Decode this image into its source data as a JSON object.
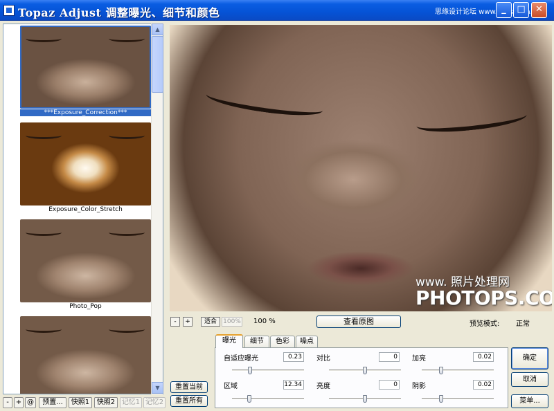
{
  "window": {
    "title": "Topaz Adjust 调整曝光、细节和颜色",
    "watermark": "思缘设计论坛 www.missyuan.com",
    "controls": {
      "minimize": "_",
      "maximize": "□",
      "close": "✕"
    }
  },
  "presets": {
    "items": [
      {
        "label": "***Exposure_Correction***",
        "selected": true
      },
      {
        "label": "Exposure_Color_Stretch",
        "selected": false
      },
      {
        "label": "Photo_Pop",
        "selected": false
      },
      {
        "label": "",
        "selected": false
      }
    ],
    "scroll_up": "▲",
    "scroll_down": "▼"
  },
  "left_toolbar": {
    "minus": "-",
    "plus": "+",
    "at": "@",
    "preset": "预置...",
    "snapshot1": "快照1",
    "snapshot2": "快照2",
    "memory1": "记忆1",
    "memory2": "记忆2"
  },
  "preview": {
    "watermark_line1": "www. 照片处理网",
    "watermark_line2": "PHOTOPS.COM",
    "zoom_out": "-",
    "zoom_in": "+",
    "fit": "适合",
    "zoom_100": "100%",
    "zoom_level": "100 %",
    "view_original": "查看原图",
    "preview_mode_label": "预览模式:",
    "preview_mode_value": "正常"
  },
  "tabs": [
    {
      "label": "曝光",
      "active": true
    },
    {
      "label": "细节",
      "active": false
    },
    {
      "label": "色彩",
      "active": false
    },
    {
      "label": "噪点",
      "active": false
    }
  ],
  "exposure": {
    "adaptive_exposure": {
      "label": "自适应曝光",
      "value": "0.23",
      "position": 0.23
    },
    "contrast": {
      "label": "对比",
      "value": "0",
      "position": 0.5
    },
    "highlights": {
      "label": "加亮",
      "value": "0.02",
      "position": 0.26
    },
    "regions": {
      "label": "区域",
      "value": "12.34",
      "position": 0.22
    },
    "brightness": {
      "label": "亮度",
      "value": "0",
      "position": 0.5
    },
    "shadows": {
      "label": "阴影",
      "value": "0.02",
      "position": 0.26
    }
  },
  "reset": {
    "current": "重置当前",
    "all": "重置所有"
  },
  "actions": {
    "ok": "确定",
    "cancel": "取消",
    "menu": "菜单..."
  }
}
